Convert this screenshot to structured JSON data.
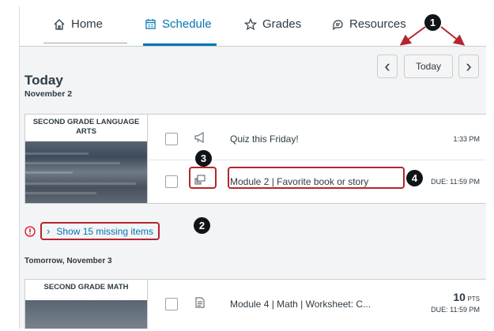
{
  "tabs": [
    {
      "label": "Home",
      "icon": "home-icon"
    },
    {
      "label": "Schedule",
      "icon": "calendar-icon",
      "active": true
    },
    {
      "label": "Grades",
      "icon": "star-icon"
    },
    {
      "label": "Resources",
      "icon": "resources-icon"
    }
  ],
  "nav": {
    "today_label": "Today",
    "prev": "‹",
    "next": "›"
  },
  "today": {
    "heading": "Today",
    "date": "November 2"
  },
  "course1": {
    "title": "SECOND GRADE LANGUAGE ARTS",
    "items": [
      {
        "icon": "megaphone-icon",
        "title": "Quiz this Friday!",
        "time": "1:33 PM"
      },
      {
        "icon": "discussion-icon",
        "title": "Module 2 | Favorite book or story",
        "time": "DUE: 11:59 PM"
      }
    ]
  },
  "missing": {
    "label": "Show 15 missing items"
  },
  "tomorrow": {
    "label": "Tomorrow, November 3"
  },
  "course2": {
    "title": "SECOND GRADE MATH",
    "items": [
      {
        "icon": "assignment-icon",
        "title": "Module 4 | Math | Worksheet: C...",
        "points": "10",
        "points_unit": "PTS",
        "time": "DUE: 11:59 PM"
      }
    ]
  },
  "callouts": [
    "1",
    "2",
    "3",
    "4"
  ],
  "colors": {
    "accent": "#0374b5",
    "callout": "#0f1418",
    "highlight": "#b5252f",
    "error": "#e0061f"
  }
}
